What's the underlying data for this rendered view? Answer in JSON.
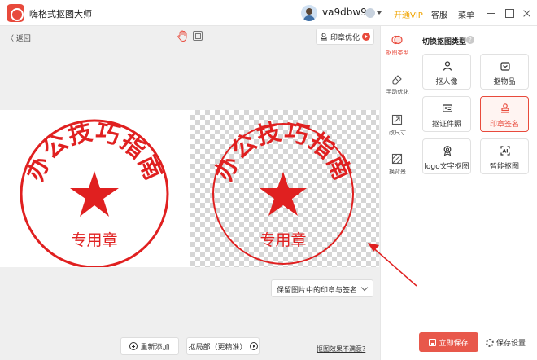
{
  "titlebar": {
    "app_title": "嗨格式抠图大师",
    "username": "va9dbw9",
    "open_vip": "开通VIP",
    "service": "客服",
    "menu": "菜单"
  },
  "toolbar": {
    "back": "〈 返回",
    "seal_optimize": "印章优化"
  },
  "images": {
    "seal_top_text": "办公技巧指南",
    "seal_bottom_text": "专用章"
  },
  "keep_select": {
    "value": "保留图片中的印章与签名"
  },
  "bottom": {
    "re_add": "重新添加",
    "partial": "抠局部（更精准）",
    "unsatisfied": "抠图效果不满意?"
  },
  "tools": [
    {
      "label": "抠图类型"
    },
    {
      "label": "手动优化"
    },
    {
      "label": "改尺寸"
    },
    {
      "label": "换背景"
    }
  ],
  "panel": {
    "title": "切换抠图类型",
    "cards": [
      {
        "label": "抠人像",
        "icon": "person-icon"
      },
      {
        "label": "抠物品",
        "icon": "box-icon"
      },
      {
        "label": "抠证件照",
        "icon": "id-card-icon"
      },
      {
        "label": "印章签名",
        "icon": "stamp-icon"
      },
      {
        "label": "logo文字抠图",
        "icon": "badge-icon"
      },
      {
        "label": "智能抠图",
        "icon": "smart-scan-icon"
      }
    ],
    "save_now": "立即保存",
    "save_settings": "保存设置"
  },
  "colors": {
    "accent": "#e84a3c",
    "seal_red": "#e02020",
    "vip": "#f0a400"
  }
}
